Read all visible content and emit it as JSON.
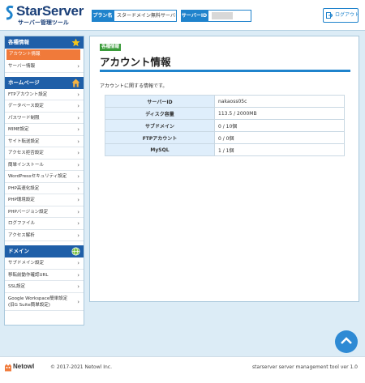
{
  "header": {
    "logo_text": "StarServer",
    "logo_sub": "サーバー管理ツール",
    "plan_label": "プラン名",
    "plan_value": "スタードメイン無料サーバー",
    "server_label": "サーバーID",
    "logout_label": "ログアウト"
  },
  "sidebar": {
    "sections": {
      "info": {
        "title": "各種情報",
        "icon": "star-icon",
        "items": [
          "アカウント情報",
          "サーバー情報"
        ]
      },
      "homepage": {
        "title": "ホームページ",
        "icon": "house-icon",
        "items": [
          "FTPアカウント設定",
          "データベース設定",
          "パスワード制限",
          "MIME設定",
          "サイト転送設定",
          "アクセス拒否設定",
          "簡単インストール",
          "WordPressセキュリティ設定",
          "PHP高速化設定",
          "PHP環境設定",
          "PHPバージョン設定",
          "ログファイル",
          "アクセス解析"
        ]
      },
      "domain": {
        "title": "ドメイン",
        "icon": "globe-icon",
        "items": [
          "サブドメイン設定",
          "移転前動作確認URL",
          "SSL設定",
          "Google Workspace簡単設定 (旧G Suite簡単設定)"
        ]
      }
    },
    "active_item": "アカウント情報"
  },
  "main": {
    "badge": "各種情報",
    "title": "アカウント情報",
    "description": "アカウントに関する情報です。",
    "rows": [
      {
        "label": "サーバーID",
        "value": "nakaoss05c"
      },
      {
        "label": "ディスク容量",
        "value": "113.5 / 2000MB"
      },
      {
        "label": "サブドメイン",
        "value": "0 / 10個"
      },
      {
        "label": "FTPアカウント",
        "value": "0 / 0個"
      },
      {
        "label": "MySQL",
        "value": "1 / 1個"
      }
    ]
  },
  "footer": {
    "brand": "Netowl",
    "copyright": "© 2017-2021 Netowl Inc.",
    "version": "starserver server management tool ver 1.0"
  },
  "colors": {
    "brand_blue": "#1f83cc",
    "sidebar_header": "#1f5fa8",
    "active_orange": "#f07a3a",
    "badge_green": "#3a9b3a",
    "background": "#dcecf6"
  }
}
